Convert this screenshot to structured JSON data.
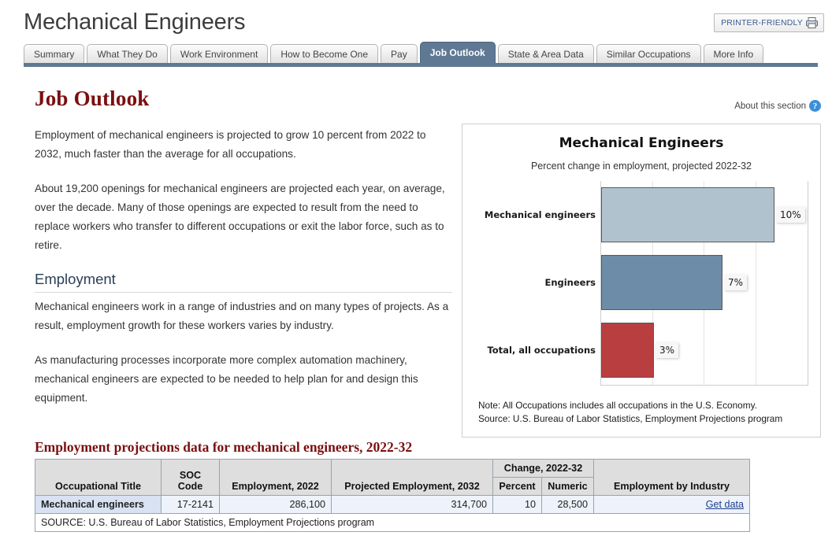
{
  "header": {
    "title": "Mechanical Engineers",
    "printer_friendly_label": "PRINTER-FRIENDLY",
    "printer_icon": "printer-icon"
  },
  "tabs": [
    {
      "label": "Summary",
      "active": false
    },
    {
      "label": "What They Do",
      "active": false
    },
    {
      "label": "Work Environment",
      "active": false
    },
    {
      "label": "How to Become One",
      "active": false
    },
    {
      "label": "Pay",
      "active": false
    },
    {
      "label": "Job Outlook",
      "active": true
    },
    {
      "label": "State & Area Data",
      "active": false
    },
    {
      "label": "Similar Occupations",
      "active": false
    },
    {
      "label": "More Info",
      "active": false
    }
  ],
  "section": {
    "heading": "Job Outlook",
    "about_label": "About this section",
    "about_icon": "question-mark-icon"
  },
  "body": {
    "paragraph_1": "Employment of mechanical engineers is projected to grow 10 percent from 2022 to 2032, much faster than the average for all occupations.",
    "paragraph_2": "About 19,200 openings for mechanical engineers are projected each year, on average, over the decade. Many of those openings are expected to result from the need to replace workers who transfer to different occupations or exit the labor force, such as to retire.",
    "employment_heading": "Employment",
    "paragraph_3": "Mechanical engineers work in a range of industries and on many types of projects. As a result, employment growth for these workers varies by industry.",
    "paragraph_4": "As manufacturing processes incorporate more complex automation machinery, mechanical engineers are expected to be needed to help plan for and design this equipment."
  },
  "chart_data": {
    "type": "bar",
    "orientation": "horizontal",
    "title": "Mechanical Engineers",
    "subtitle": "Percent change in employment, projected 2022-32",
    "xlabel": "",
    "ylabel": "",
    "categories": [
      "Mechanical engineers",
      "Engineers",
      "Total, all occupations"
    ],
    "values": [
      10,
      7,
      3
    ],
    "value_labels": [
      "10%",
      "7%",
      "3%"
    ],
    "xlim": [
      0,
      12
    ],
    "gridlines": [
      3,
      6,
      9,
      12
    ],
    "grid": true,
    "legend": "none",
    "colors": [
      "#b0c2ce",
      "#6d8ca8",
      "#b93e40"
    ],
    "bar_border_color": "#58595b",
    "note": "Note: All Occupations includes all occupations in the U.S. Economy.",
    "source": "Source: U.S. Bureau of Labor Statistics, Employment Projections program"
  },
  "table": {
    "title": "Employment projections data for mechanical engineers, 2022-32",
    "group_header": "Change, 2022-32",
    "headers": [
      "Occupational Title",
      "SOC Code",
      "Employment, 2022",
      "Projected Employment, 2032",
      "Percent",
      "Numeric",
      "Employment by Industry"
    ],
    "rows": [
      {
        "occupational_title": "Mechanical engineers",
        "soc_code": "17-2141",
        "employment_2022": "286,100",
        "projected_employment_2032": "314,700",
        "change_percent": "10",
        "change_numeric": "28,500",
        "employment_by_industry": "Get data"
      }
    ],
    "source": "SOURCE: U.S. Bureau of Labor Statistics, Employment Projections program"
  }
}
